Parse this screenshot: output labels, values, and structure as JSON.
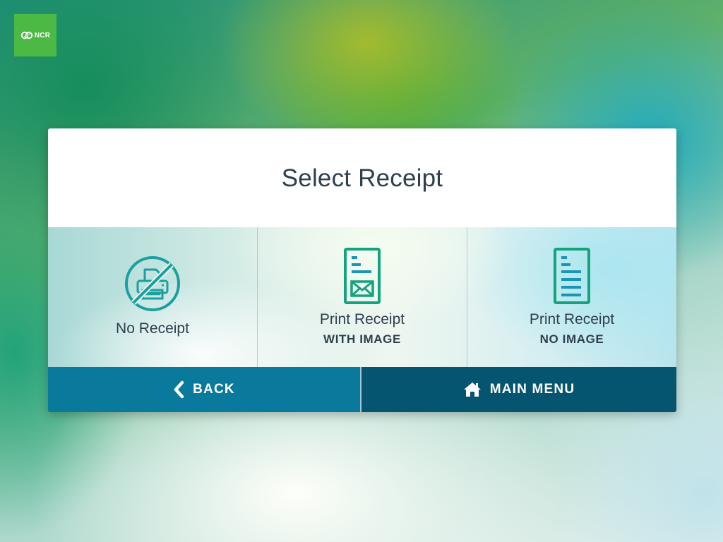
{
  "logo": {
    "text": "NCR",
    "color": "#4cb944"
  },
  "dialog": {
    "title": "Select Receipt",
    "options": [
      {
        "icon": "no-printer-icon",
        "line1": "No Receipt",
        "line2": ""
      },
      {
        "icon": "receipt-with-image-icon",
        "line1": "Print Receipt",
        "line2": "WITH IMAGE"
      },
      {
        "icon": "receipt-no-image-icon",
        "line1": "Print Receipt",
        "line2": "NO IMAGE"
      }
    ],
    "back_label": "BACK",
    "main_menu_label": "MAIN MENU"
  },
  "colors": {
    "accent_icon": "#1aa0a0",
    "back_button": "#0a7a9c",
    "main_menu_button": "#065570",
    "title_text": "#2e3f4d"
  }
}
